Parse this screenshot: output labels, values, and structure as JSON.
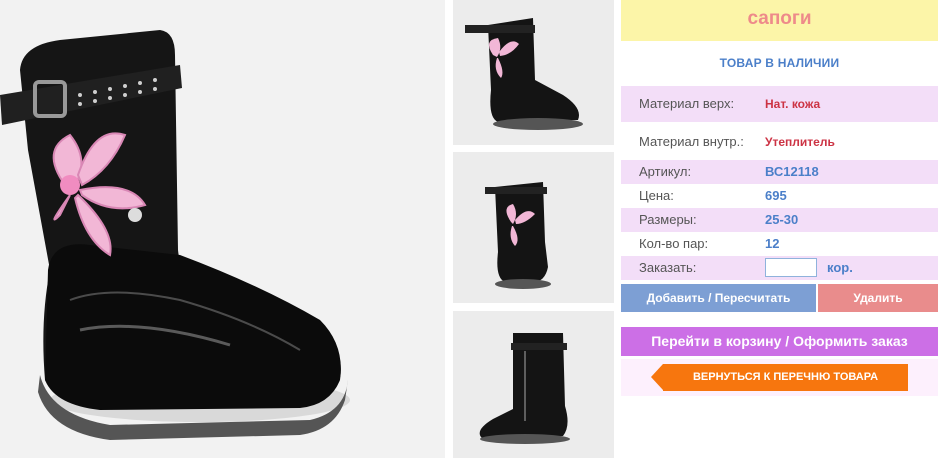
{
  "product": {
    "title": "сапоги",
    "stock_status": "ТОВАР В НАЛИЧИИ"
  },
  "specs": {
    "material_upper": {
      "label": "Материал верх:",
      "value": "Нат. кожа"
    },
    "material_inner": {
      "label": "Материал внутр.:",
      "value": "Утеплитель"
    },
    "article": {
      "label": "Артикул:",
      "value": "ВС12118"
    },
    "price": {
      "label": "Цена:",
      "value": "695"
    },
    "sizes": {
      "label": "Размеры:",
      "value": "25-30"
    },
    "pairs": {
      "label": "Кол-во пар:",
      "value": "12"
    }
  },
  "order": {
    "label": "Заказать:",
    "quantity_value": "",
    "unit": "кор."
  },
  "buttons": {
    "add": "Добавить / Пересчитать",
    "delete": "Удалить",
    "cart": "Перейти в корзину / Оформить заказ",
    "back": "ВЕРНУТЬСЯ К ПЕРЕЧНЮ ТОВАРА"
  },
  "colors": {
    "title_bg": "#fcf5a8",
    "title_text": "#ee8a8a",
    "accent_blue": "#4b7fc9",
    "value_red": "#cc3344",
    "row_pink": "#f3def8",
    "add_button": "#7d9fd4",
    "delete_button": "#e98c8c",
    "cart_button": "#cc6fe6",
    "back_button": "#f7760e"
  },
  "images": {
    "main": "boot-photo-side-view",
    "thumbs": [
      "boot-thumb-side",
      "boot-thumb-angle",
      "boot-thumb-inner-side"
    ]
  }
}
